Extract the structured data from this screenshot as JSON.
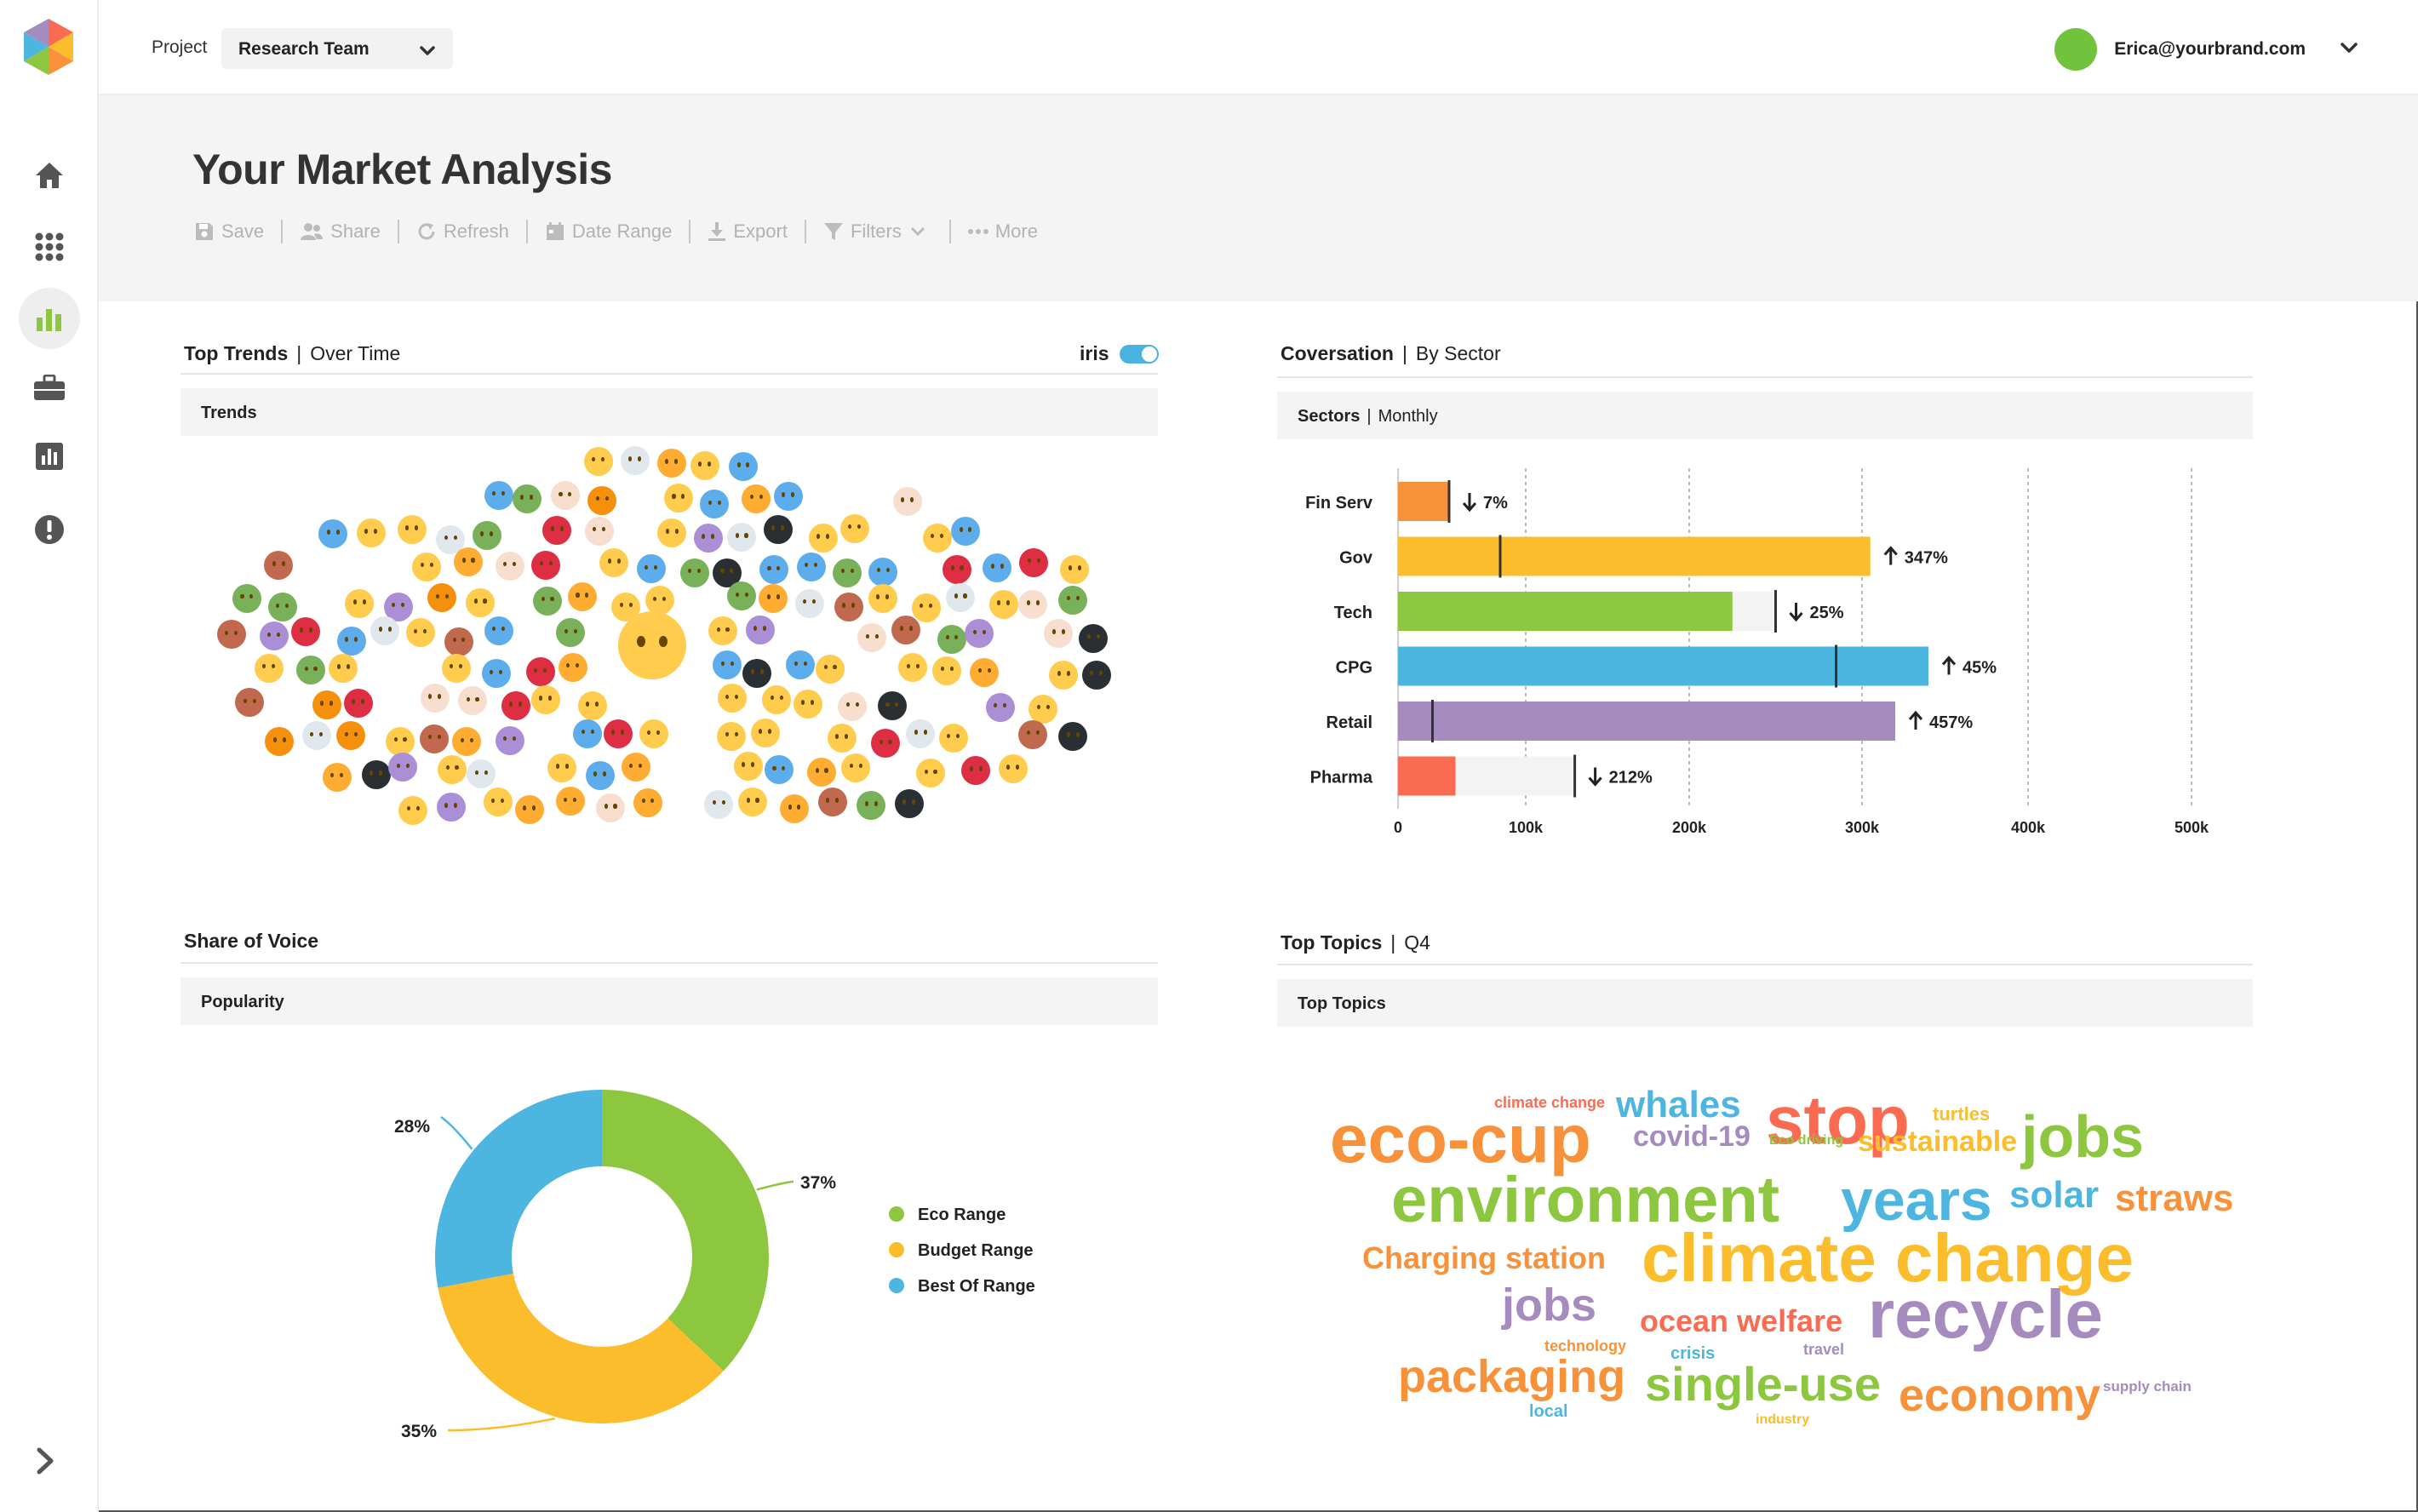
{
  "topbar": {
    "project_label": "Project",
    "project_value": "Research Team",
    "user_email": "Erica@yourbrand.com"
  },
  "sidebar": {
    "items": [
      {
        "icon": "home-icon"
      },
      {
        "icon": "apps-grid-icon"
      },
      {
        "icon": "bar-chart-icon",
        "active": true
      },
      {
        "icon": "briefcase-icon"
      },
      {
        "icon": "report-icon"
      },
      {
        "icon": "alert-icon"
      }
    ],
    "expand_icon": "chevron-right-icon"
  },
  "header": {
    "title": "Your Market Analysis",
    "toolbar": {
      "save": "Save",
      "share": "Share",
      "refresh": "Refresh",
      "date_range": "Date Range",
      "export": "Export",
      "filters": "Filters",
      "more": "More"
    }
  },
  "panels": {
    "trends": {
      "title": "Top Trends",
      "subtitle": "Over Time",
      "toggle_label": "iris",
      "toggle_on": true,
      "sub_bar": "Trends"
    },
    "sectors": {
      "title": "Coversation",
      "subtitle": "By Sector",
      "sub_bar_bold": "Sectors",
      "sub_bar_rest": "Monthly"
    },
    "voice": {
      "title": "Share of Voice",
      "sub_bar": "Popularity"
    },
    "topics": {
      "title": "Top Topics",
      "subtitle": "Q4",
      "sub_bar": "Top Topics"
    }
  },
  "colors": {
    "green": "#8dc63f",
    "yellow": "#fbbd2c",
    "blue": "#4db6e0",
    "orange": "#f7923a",
    "purple": "#a68bbf",
    "red": "#fb6b52",
    "avatar": "#71c23d"
  },
  "chart_data": [
    {
      "type": "bar",
      "orientation": "horizontal",
      "categories": [
        "Fin Serv",
        "Gov",
        "Tech",
        "CPG",
        "Retail",
        "Pharma"
      ],
      "values": [
        40000,
        305000,
        225000,
        340000,
        320000,
        45000
      ],
      "targets": [
        40000,
        80000,
        250000,
        285000,
        27000,
        130000
      ],
      "totals": [
        40000,
        305000,
        250000,
        340000,
        320000,
        130000
      ],
      "colors": [
        "#f7923a",
        "#fbbd2c",
        "#8dc63f",
        "#4db6e0",
        "#a68bbf",
        "#fb6b52"
      ],
      "changes": [
        {
          "dir": "down",
          "label": "7%"
        },
        {
          "dir": "up",
          "label": "347%"
        },
        {
          "dir": "down",
          "label": "25%"
        },
        {
          "dir": "up",
          "label": "45%"
        },
        {
          "dir": "up",
          "label": "457%"
        },
        {
          "dir": "down",
          "label": "212%"
        }
      ],
      "xticks": [
        "0",
        "100k",
        "200k",
        "300k",
        "400k",
        "500k"
      ],
      "xlim": [
        0,
        500000
      ],
      "grid": true
    },
    {
      "type": "pie",
      "donut": true,
      "slices": [
        {
          "name": "Eco Range",
          "value": 37,
          "label": "37%",
          "color": "#8dc63f"
        },
        {
          "name": "Budget Range",
          "value": 35,
          "label": "35%",
          "color": "#fbbd2c"
        },
        {
          "name": "Best Of Range",
          "value": 28,
          "label": "28%",
          "color": "#4db6e0"
        }
      ],
      "legend": "right"
    }
  ],
  "wordcloud": [
    {
      "text": "climate change",
      "color": "#fb6b52",
      "size": "small"
    },
    {
      "text": "whales",
      "color": "#4db6e0",
      "size": "medium"
    },
    {
      "text": "stop",
      "color": "#fb6b52",
      "size": "xlarge"
    },
    {
      "text": "turtles",
      "color": "#fbbd2c",
      "size": "small"
    },
    {
      "text": "eco-cup",
      "color": "#f7923a",
      "size": "xlarge"
    },
    {
      "text": "covid-19",
      "color": "#a68bbf",
      "size": "medium"
    },
    {
      "text": "Eco driving",
      "color": "#8dc63f",
      "size": "tiny"
    },
    {
      "text": "sustainable",
      "color": "#fbbd2c",
      "size": "medium"
    },
    {
      "text": "jobs",
      "color": "#8dc63f",
      "size": "xlarge"
    },
    {
      "text": "environment",
      "color": "#8dc63f",
      "size": "xlarge"
    },
    {
      "text": "years",
      "color": "#4db6e0",
      "size": "xlarge"
    },
    {
      "text": "solar",
      "color": "#4db6e0",
      "size": "medium"
    },
    {
      "text": "straws",
      "color": "#f7923a",
      "size": "medium"
    },
    {
      "text": "Charging station",
      "color": "#f7923a",
      "size": "medium"
    },
    {
      "text": "climate change",
      "color": "#fbbd2c",
      "size": "xlarge"
    },
    {
      "text": "jobs",
      "color": "#a68bbf",
      "size": "large"
    },
    {
      "text": "ocean welfare",
      "color": "#fb6b52",
      "size": "medium"
    },
    {
      "text": "recycle",
      "color": "#a68bbf",
      "size": "xlarge"
    },
    {
      "text": "technology",
      "color": "#f7923a",
      "size": "tiny"
    },
    {
      "text": "crisis",
      "color": "#4db6e0",
      "size": "small"
    },
    {
      "text": "travel",
      "color": "#a68bbf",
      "size": "tiny"
    },
    {
      "text": "packaging",
      "color": "#f7923a",
      "size": "large"
    },
    {
      "text": "single-use",
      "color": "#8dc63f",
      "size": "large"
    },
    {
      "text": "economy",
      "color": "#f7923a",
      "size": "large"
    },
    {
      "text": "supply chain",
      "color": "#a68bbf",
      "size": "tiny"
    },
    {
      "text": "local",
      "color": "#4db6e0",
      "size": "small"
    },
    {
      "text": "industry",
      "color": "#fbbd2c",
      "size": "tiny"
    }
  ]
}
